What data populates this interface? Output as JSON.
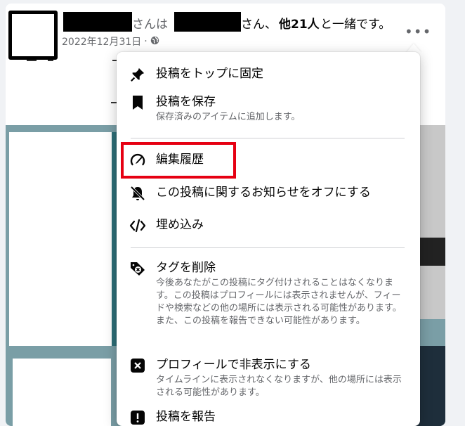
{
  "post": {
    "header_suffix_1": "さんは",
    "header_suffix_2": "さん、",
    "header_others": "他21人",
    "header_tail": "と一緒です。",
    "date": "2022年12月31日",
    "date_sep": "·",
    "audience_icon": "globe-icon",
    "more_icon": "more-horizontal-icon"
  },
  "menu": {
    "items": [
      {
        "icon": "pin-icon",
        "label": "投稿をトップに固定",
        "desc": ""
      },
      {
        "icon": "bookmark-icon",
        "label": "投稿を保存",
        "desc": "保存済みのアイテムに追加します。"
      },
      {
        "icon": "edit-history-icon",
        "label": "編集履歴",
        "desc": ""
      },
      {
        "icon": "bell-off-icon",
        "label": "この投稿に関するお知らせをオフにする",
        "desc": ""
      },
      {
        "icon": "embed-code-icon",
        "label": "埋め込み",
        "desc": ""
      },
      {
        "icon": "tag-remove-icon",
        "label": "タグを削除",
        "desc": "今後あなたがこの投稿にタグ付けされることはなくなります。この投稿はプロフィールには表示されませんが、フィードや検索などの他の場所には表示される可能性があります。また、この投稿を報告できない可能性があります。"
      },
      {
        "icon": "hide-from-profile-icon",
        "label": "プロフィールで非表示にする",
        "desc": "タイムラインに表示されなくなりますが、他の場所には表示される可能性があります。"
      },
      {
        "icon": "report-icon",
        "label": "投稿を報告",
        "desc": ""
      }
    ]
  },
  "colors": {
    "highlight_border": "#e60012",
    "secondary_text": "#65676b",
    "primary_text": "#050505"
  }
}
